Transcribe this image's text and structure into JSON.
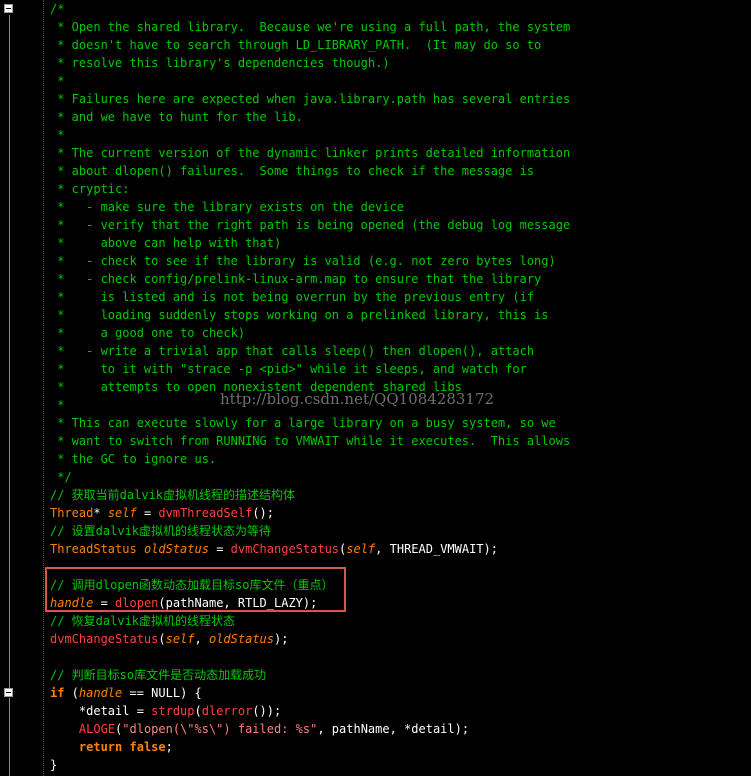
{
  "watermark": "http://blog.csdn.net/QQ1084283172",
  "colors": {
    "background": "#000000",
    "comment": "#00c800",
    "keyword": "#ff8000",
    "function": "#ff4040",
    "string": "#ff8080",
    "text": "#ffffff",
    "highlight_box": "#d9534f"
  },
  "fold_icons": [
    "minus-fold-icon",
    "minus-fold-icon"
  ],
  "code_lines": [
    [
      {
        "t": "/*",
        "c": "c"
      }
    ],
    [
      {
        "t": " * Open the shared library.  Because we're using a full path, the system",
        "c": "c"
      }
    ],
    [
      {
        "t": " * doesn't have to search through LD_LIBRARY_PATH.  (It may do so to",
        "c": "c"
      }
    ],
    [
      {
        "t": " * resolve this library's dependencies though.)",
        "c": "c"
      }
    ],
    [
      {
        "t": " *",
        "c": "c"
      }
    ],
    [
      {
        "t": " * Failures here are expected when java.library.path has several entries",
        "c": "c"
      }
    ],
    [
      {
        "t": " * and we have to hunt for the lib.",
        "c": "c"
      }
    ],
    [
      {
        "t": " *",
        "c": "c"
      }
    ],
    [
      {
        "t": " * The current version of the dynamic linker prints detailed information",
        "c": "c"
      }
    ],
    [
      {
        "t": " * about dlopen() failures.  Some things to check if the message is",
        "c": "c"
      }
    ],
    [
      {
        "t": " * cryptic:",
        "c": "c"
      }
    ],
    [
      {
        "t": " *   - make sure the library exists on the device",
        "c": "c"
      }
    ],
    [
      {
        "t": " *   - verify that the right path is being opened (the debug log message",
        "c": "c"
      }
    ],
    [
      {
        "t": " *     above can help with that)",
        "c": "c"
      }
    ],
    [
      {
        "t": " *   - check to see if the library is valid (e.g. not zero bytes long)",
        "c": "c"
      }
    ],
    [
      {
        "t": " *   - check config/prelink-linux-arm.map to ensure that the library",
        "c": "c"
      }
    ],
    [
      {
        "t": " *     is listed and is not being overrun by the previous entry (if",
        "c": "c"
      }
    ],
    [
      {
        "t": " *     loading suddenly stops working on a prelinked library, this is",
        "c": "c"
      }
    ],
    [
      {
        "t": " *     a good one to check)",
        "c": "c"
      }
    ],
    [
      {
        "t": " *   - write a trivial app that calls sleep() then dlopen(), attach",
        "c": "c"
      }
    ],
    [
      {
        "t": " *     to it with \"strace -p <pid>\" while it sleeps, and watch for",
        "c": "c"
      }
    ],
    [
      {
        "t": " *     attempts to open nonexistent dependent shared libs",
        "c": "c"
      }
    ],
    [
      {
        "t": " *",
        "c": "c"
      }
    ],
    [
      {
        "t": " * This can execute slowly for a large library on a busy system, so we",
        "c": "c"
      }
    ],
    [
      {
        "t": " * want to switch from RUNNING to VMWAIT while it executes.  This allows",
        "c": "c"
      }
    ],
    [
      {
        "t": " * the GC to ignore us.",
        "c": "c"
      }
    ],
    [
      {
        "t": " */",
        "c": "c"
      }
    ],
    [
      {
        "t": "// 获取当前dalvik虚拟机线程的描述结构体",
        "c": "c"
      }
    ],
    [
      {
        "t": "Thread",
        "c": "t"
      },
      {
        "t": "* ",
        "c": "w"
      },
      {
        "t": "self",
        "c": "v"
      },
      {
        "t": " = ",
        "c": "w"
      },
      {
        "t": "dvmThreadSelf",
        "c": "f"
      },
      {
        "t": "();",
        "c": "w"
      }
    ],
    [
      {
        "t": "// 设置dalvik虚拟机的线程状态为等待",
        "c": "c"
      }
    ],
    [
      {
        "t": "ThreadStatus",
        "c": "t"
      },
      {
        "t": " ",
        "c": "w"
      },
      {
        "t": "oldStatus",
        "c": "v"
      },
      {
        "t": " = ",
        "c": "w"
      },
      {
        "t": "dvmChangeStatus",
        "c": "f"
      },
      {
        "t": "(",
        "c": "w"
      },
      {
        "t": "self",
        "c": "v"
      },
      {
        "t": ", THREAD_VMWAIT);",
        "c": "w"
      }
    ],
    [
      {
        "t": "",
        "c": "w"
      }
    ],
    [
      {
        "t": "// 调用dlopen函数动态加载目标so库文件（重点）",
        "c": "c"
      }
    ],
    [
      {
        "t": "handle",
        "c": "v"
      },
      {
        "t": " = ",
        "c": "w"
      },
      {
        "t": "dlopen",
        "c": "f"
      },
      {
        "t": "(pathName, RTLD_LAZY);",
        "c": "w"
      }
    ],
    [
      {
        "t": "// 恢复dalvik虚拟机的线程状态",
        "c": "c"
      }
    ],
    [
      {
        "t": "dvmChangeStatus",
        "c": "f"
      },
      {
        "t": "(",
        "c": "w"
      },
      {
        "t": "self",
        "c": "v"
      },
      {
        "t": ", ",
        "c": "w"
      },
      {
        "t": "oldStatus",
        "c": "v"
      },
      {
        "t": ");",
        "c": "w"
      }
    ],
    [
      {
        "t": "",
        "c": "w"
      }
    ],
    [
      {
        "t": "// 判断目标so库文件是否动态加载成功",
        "c": "c"
      }
    ],
    [
      {
        "t": "if",
        "c": "k"
      },
      {
        "t": " (",
        "c": "w"
      },
      {
        "t": "handle",
        "c": "v"
      },
      {
        "t": " == NULL) {",
        "c": "w"
      }
    ],
    [
      {
        "t": "    *detail = ",
        "c": "w"
      },
      {
        "t": "strdup",
        "c": "f"
      },
      {
        "t": "(",
        "c": "w"
      },
      {
        "t": "dlerror",
        "c": "f"
      },
      {
        "t": "());",
        "c": "w"
      }
    ],
    [
      {
        "t": "    ",
        "c": "w"
      },
      {
        "t": "ALOGE",
        "c": "f"
      },
      {
        "t": "(",
        "c": "w"
      },
      {
        "t": "\"dlopen(\\\"%s\\\") failed: %s\"",
        "c": "s"
      },
      {
        "t": ", pathName, *detail);",
        "c": "w"
      }
    ],
    [
      {
        "t": "    ",
        "c": "w"
      },
      {
        "t": "return",
        "c": "k"
      },
      {
        "t": " ",
        "c": "w"
      },
      {
        "t": "false",
        "c": "k"
      },
      {
        "t": ";",
        "c": "w"
      }
    ],
    [
      {
        "t": "}",
        "c": "w"
      }
    ]
  ]
}
